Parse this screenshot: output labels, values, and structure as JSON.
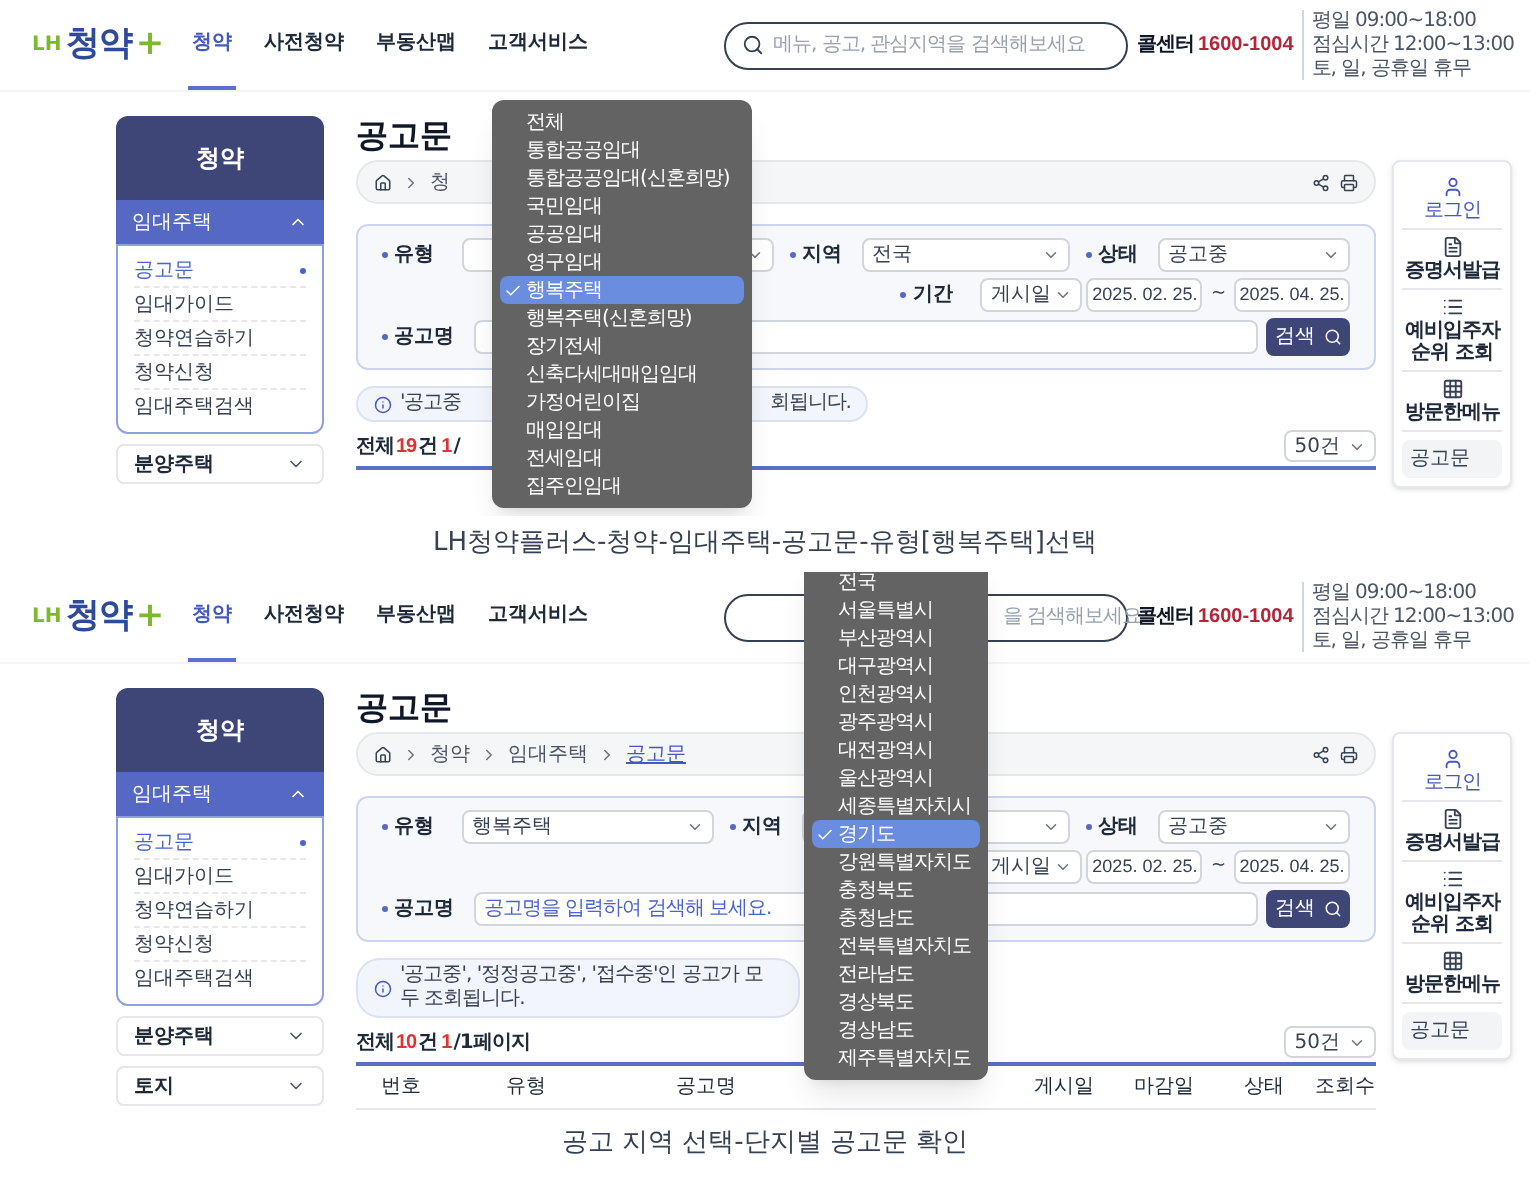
{
  "screens": [
    {
      "header": {
        "logo": {
          "prefix": "LH",
          "name": "청약",
          "plus": "+"
        },
        "nav": [
          {
            "label": "청약",
            "selected": true
          },
          {
            "label": "사전청약",
            "selected": false
          },
          {
            "label": "부동산맵",
            "selected": false
          },
          {
            "label": "고객서비스",
            "selected": false
          }
        ],
        "search": {
          "placeholder": "메뉴, 공고, 관심지역을 검색해보세요",
          "show_icon": true
        },
        "call_center": {
          "label": "콜센터",
          "number": "1600-1004"
        },
        "hours": [
          "평일 09:00~18:00",
          "점심시간 12:00~13:00",
          "토, 일, 공휴일 휴무"
        ]
      },
      "sidebar": {
        "title": "청약",
        "sections": [
          {
            "label": "임대주택",
            "expanded": true,
            "items": [
              {
                "label": "공고문",
                "selected": true
              },
              {
                "label": "임대가이드",
                "selected": false
              },
              {
                "label": "청약연습하기",
                "selected": false
              },
              {
                "label": "청약신청",
                "selected": false
              },
              {
                "label": "임대주택검색",
                "selected": false
              }
            ]
          },
          {
            "label": "분양주택",
            "expanded": false
          }
        ]
      },
      "main": {
        "title": "공고문",
        "breadcrumb": [
          {
            "label": "청",
            "current": false
          }
        ],
        "filters": {
          "type": {
            "label": "유형"
          },
          "region": {
            "label": "지역",
            "value": "전국"
          },
          "status": {
            "label": "상태",
            "value": "공고중"
          },
          "period": {
            "label": "기간",
            "basis": "게시일",
            "start": "2025. 02. 25.",
            "end": "2025. 04. 25.",
            "separator": "~"
          },
          "name": {
            "label": "공고명"
          },
          "search_button": "검색"
        },
        "info": [
          "'공고중",
          "회됩니다."
        ],
        "count": {
          "label": "전체",
          "total": "19",
          "unit": "건",
          "page": "1",
          "pages": "/"
        },
        "page_size": "50건"
      },
      "quick_menu": {
        "items": [
          {
            "kind": "login",
            "label": "로그인"
          },
          {
            "kind": "certificate",
            "label": "증명서발급"
          },
          {
            "kind": "ranking",
            "label": "예비입주자 순위 조회"
          },
          {
            "kind": "recent",
            "label": "방문한메뉴"
          }
        ],
        "recent": [
          "공고문"
        ]
      },
      "dropdown": [
        {
          "label": "전체",
          "selected": false
        },
        {
          "label": "통합공공임대",
          "selected": false
        },
        {
          "label": "통합공공임대(신혼희망)",
          "selected": false
        },
        {
          "label": "국민임대",
          "selected": false
        },
        {
          "label": "공공임대",
          "selected": false
        },
        {
          "label": "영구임대",
          "selected": false
        },
        {
          "label": "행복주택",
          "selected": true
        },
        {
          "label": "행복주택(신혼희망)",
          "selected": false
        },
        {
          "label": "장기전세",
          "selected": false
        },
        {
          "label": "신축다세대매입임대",
          "selected": false
        },
        {
          "label": "가정어린이집",
          "selected": false
        },
        {
          "label": "매입임대",
          "selected": false
        },
        {
          "label": "전세임대",
          "selected": false
        },
        {
          "label": "집주인임대",
          "selected": false
        }
      ],
      "caption": "LH청약플러스-청약-임대주택-공고문-유형[행복주택]선택"
    },
    {
      "header": {
        "logo": {
          "prefix": "LH",
          "name": "청약",
          "plus": "+"
        },
        "nav": [
          {
            "label": "청약",
            "selected": true
          },
          {
            "label": "사전청약",
            "selected": false
          },
          {
            "label": "부동산맵",
            "selected": false
          },
          {
            "label": "고객서비스",
            "selected": false
          }
        ],
        "search": {
          "placeholder": "을 검색해보세요",
          "show_icon": false
        },
        "call_center": {
          "label": "콜센터",
          "number": "1600-1004"
        },
        "hours": [
          "평일 09:00~18:00",
          "점심시간 12:00~13:00",
          "토, 일, 공휴일 휴무"
        ]
      },
      "sidebar": {
        "title": "청약",
        "sections": [
          {
            "label": "임대주택",
            "expanded": true,
            "items": [
              {
                "label": "공고문",
                "selected": true
              },
              {
                "label": "임대가이드",
                "selected": false
              },
              {
                "label": "청약연습하기",
                "selected": false
              },
              {
                "label": "청약신청",
                "selected": false
              },
              {
                "label": "임대주택검색",
                "selected": false
              }
            ]
          },
          {
            "label": "분양주택",
            "expanded": false
          },
          {
            "label": "토지",
            "expanded": false
          }
        ]
      },
      "main": {
        "title": "공고문",
        "breadcrumb": [
          {
            "label": "청약",
            "current": false
          },
          {
            "label": "임대주택",
            "current": false
          },
          {
            "label": "공고문",
            "current": true
          }
        ],
        "filters": {
          "type": {
            "label": "유형",
            "value": "행복주택"
          },
          "region": {
            "label": "지역"
          },
          "status": {
            "label": "상태",
            "value": "공고중"
          },
          "period": {
            "basis": "게시일",
            "start": "2025. 02. 25.",
            "end": "2025. 04. 25.",
            "separator": "~"
          },
          "name": {
            "label": "공고명",
            "placeholder": "공고명을 입력하여 검색해 보세요."
          },
          "search_button": "검색"
        },
        "info": [
          "'공고중', '정정공고중', '접수중'인 공고가 모두 조회됩니다."
        ],
        "count": {
          "label": "전체",
          "total": "10",
          "unit": "건",
          "page": "1",
          "pages": "/1페이지"
        },
        "page_size": "50건",
        "table_columns": [
          "번호",
          "유형",
          "공고명",
          "게시일",
          "마감일",
          "상태",
          "조회수"
        ]
      },
      "quick_menu": {
        "items": [
          {
            "kind": "login",
            "label": "로그인"
          },
          {
            "kind": "certificate",
            "label": "증명서발급"
          },
          {
            "kind": "ranking",
            "label": "예비입주자 순위 조회"
          },
          {
            "kind": "recent",
            "label": "방문한메뉴"
          }
        ],
        "recent": [
          "공고문"
        ]
      },
      "dropdown": [
        {
          "label": "전국",
          "selected": false
        },
        {
          "label": "서울특별시",
          "selected": false
        },
        {
          "label": "부산광역시",
          "selected": false
        },
        {
          "label": "대구광역시",
          "selected": false
        },
        {
          "label": "인천광역시",
          "selected": false
        },
        {
          "label": "광주광역시",
          "selected": false
        },
        {
          "label": "대전광역시",
          "selected": false
        },
        {
          "label": "울산광역시",
          "selected": false
        },
        {
          "label": "세종특별자치시",
          "selected": false
        },
        {
          "label": "경기도",
          "selected": true
        },
        {
          "label": "강원특별자치도",
          "selected": false
        },
        {
          "label": "충청북도",
          "selected": false
        },
        {
          "label": "충청남도",
          "selected": false
        },
        {
          "label": "전북특별자치도",
          "selected": false
        },
        {
          "label": "전라남도",
          "selected": false
        },
        {
          "label": "경상북도",
          "selected": false
        },
        {
          "label": "경상남도",
          "selected": false
        },
        {
          "label": "제주특별자치도",
          "selected": false
        }
      ],
      "caption": "공고 지역 선택-단지별 공고문 확인"
    }
  ]
}
